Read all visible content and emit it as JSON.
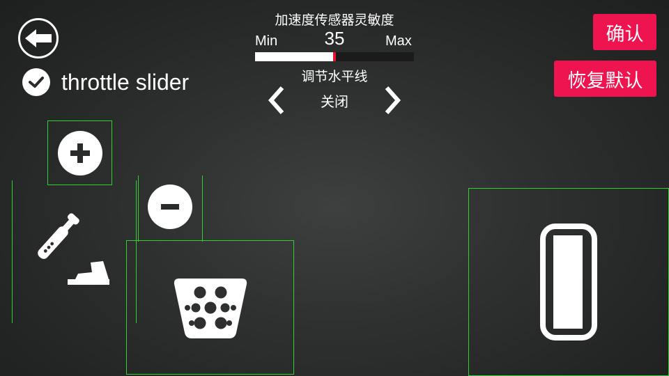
{
  "header": {
    "back_icon": "arrow-left-icon"
  },
  "throttle_toggle": {
    "label": "throttle slider",
    "checked": true,
    "icon": "check-circle-icon"
  },
  "sensitivity": {
    "title": "加速度传感器灵敏度",
    "min_label": "Min",
    "max_label": "Max",
    "value": "35",
    "fill_fraction": 0.5,
    "accent_color": "#e8102c"
  },
  "horizon": {
    "title": "调节水平线",
    "value": "关闭",
    "prev_icon": "chevron-left-icon",
    "next_icon": "chevron-right-icon"
  },
  "buttons": {
    "confirm_label": "确认",
    "reset_label": "恢复默认",
    "color": "#ee1450"
  },
  "controls": {
    "shift_up_icon": "plus-circle-icon",
    "shift_down_icon": "minus-circle-icon",
    "handbrake_icon": "handbrake-lever-icon",
    "brake_icon": "brake-pedal-icon",
    "throttle_icon": "throttle-bar-icon",
    "outline_color": "#2fd02f"
  }
}
